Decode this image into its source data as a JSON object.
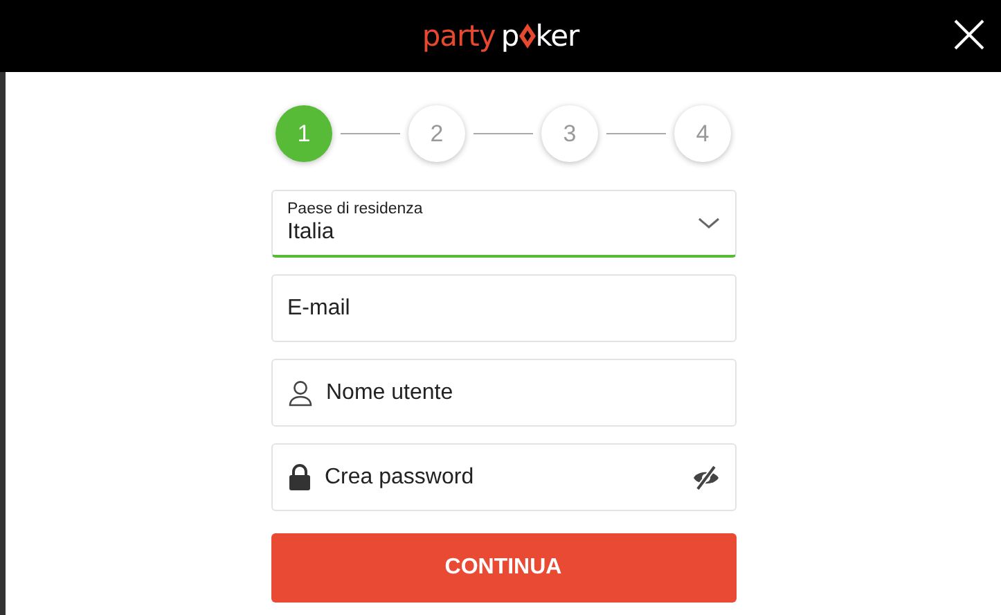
{
  "header": {
    "logo": {
      "part_1": "party",
      "part_2": "p",
      "part_3": "ker"
    }
  },
  "steps": [
    {
      "label": "1",
      "selected": true
    },
    {
      "label": "2",
      "selected": false
    },
    {
      "label": "3",
      "selected": false
    },
    {
      "label": "4",
      "selected": false
    }
  ],
  "fields": [
    {
      "kind": "select",
      "label": "Paese di residenza",
      "value": "Italia",
      "valid": true
    },
    {
      "kind": "email",
      "placeholder": "E-mail"
    },
    {
      "kind": "username",
      "placeholder": "Nome utente"
    },
    {
      "kind": "password",
      "placeholder": "Crea password",
      "masked": true
    }
  ],
  "submit": "CONTINUA"
}
